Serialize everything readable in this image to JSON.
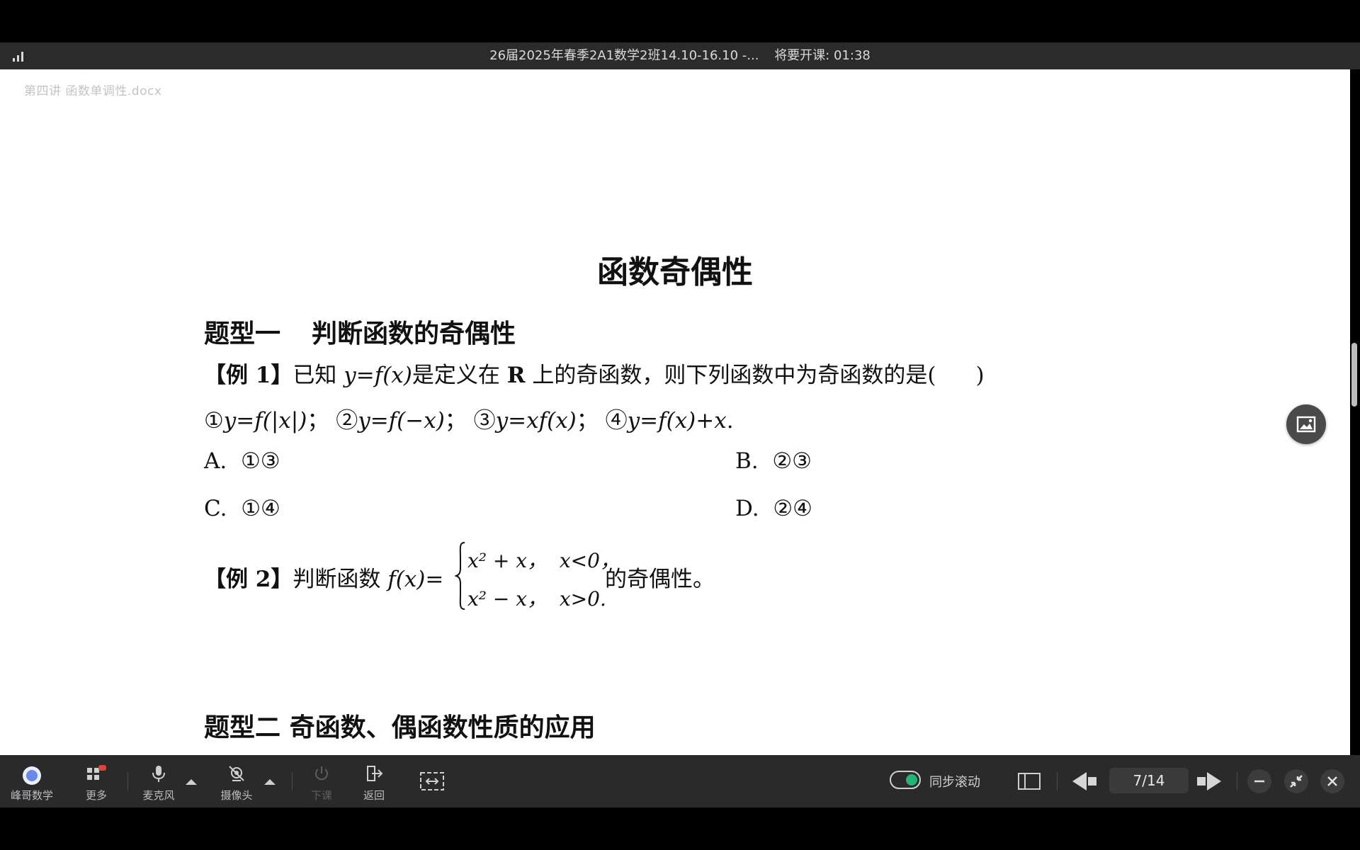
{
  "window": {
    "title": "26届2025年春季2A1数学2班14.10-16.10 -...",
    "status": "将要开课: 01:38"
  },
  "document": {
    "filename": "第四讲 函数单调性.docx",
    "title": "函数奇偶性",
    "section1": {
      "label": "题型一",
      "name": "判断函数的奇偶性"
    },
    "example1": {
      "tag": "【例 1】",
      "text_a": "已知",
      "y": "y",
      "eq": "=",
      "fx": "f(x)",
      "text_b": "是定义在",
      "R": "R",
      "text_c": "上的奇函数，则下列函数中为奇函数的是(",
      "close": ")",
      "items": [
        {
          "num": "①",
          "expr": "y=f(|x|)",
          "sep": "；"
        },
        {
          "num": "②",
          "expr": "y=f(−x)",
          "sep": "；"
        },
        {
          "num": "③",
          "expr": "y=xf(x)",
          "sep": "；"
        },
        {
          "num": "④",
          "expr": "y=f(x)+x",
          "sep": "."
        }
      ],
      "options": [
        {
          "letter": "A.",
          "value": "①③"
        },
        {
          "letter": "B.",
          "value": "②③"
        },
        {
          "letter": "C.",
          "value": "①④"
        },
        {
          "letter": "D.",
          "value": "②④"
        }
      ]
    },
    "example2": {
      "tag": "【例 2】",
      "text_a": "判断函数",
      "fx": "f(x)",
      "eq": "=",
      "case1": {
        "expr": "x² + x，",
        "cond": "x<0，"
      },
      "case2": {
        "expr": "x² − x，",
        "cond": "x>0."
      },
      "text_b": "的奇偶性。"
    },
    "section2": {
      "label": "题型二",
      "name": "奇函数、偶函数性质的应用"
    }
  },
  "toolbar": {
    "app": "峰哥数学",
    "more": "更多",
    "mic": "麦克风",
    "camera": "摄像头",
    "end_class": "下课",
    "back": "返回",
    "sync_scroll": "同步滚动",
    "page_current": "7",
    "page_total": "/14"
  }
}
